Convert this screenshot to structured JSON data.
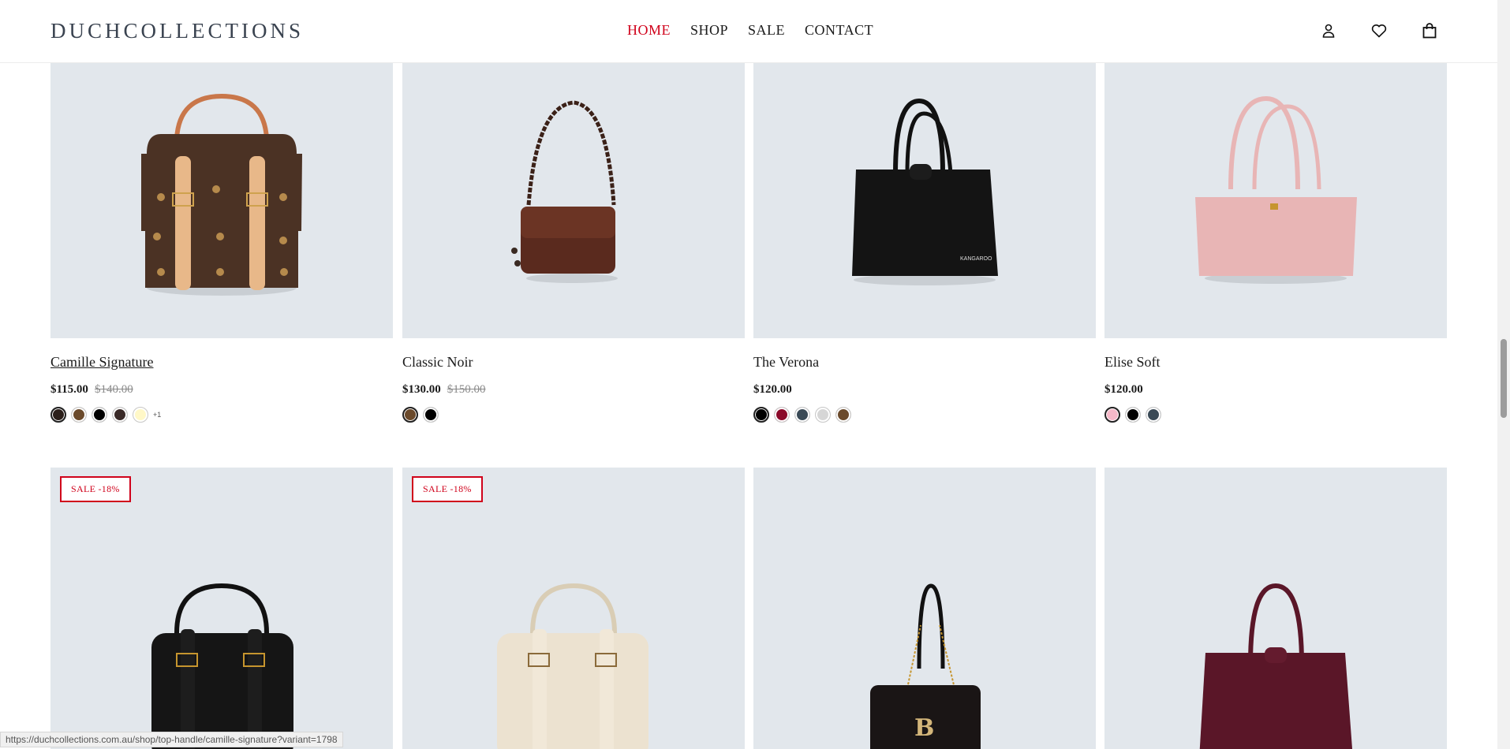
{
  "header": {
    "logo": "DUCHCOLLECTIONS",
    "nav": [
      {
        "label": "HOME",
        "active": true
      },
      {
        "label": "SHOP",
        "active": false
      },
      {
        "label": "SALE",
        "active": false
      },
      {
        "label": "CONTACT",
        "active": false
      }
    ],
    "icons": [
      "account-icon",
      "wishlist-heart-icon",
      "cart-bag-icon"
    ]
  },
  "products_row1": [
    {
      "title": "Camille Signature",
      "price": "$115.00",
      "old_price": "$140.00",
      "swatches": [
        "#2b1f1a",
        "#6b4a2b",
        "#000000",
        "#3a2a28",
        "#fff8c7"
      ],
      "more": "+1"
    },
    {
      "title": "Classic Noir",
      "price": "$130.00",
      "old_price": "$150.00",
      "swatches": [
        "#6b4a2b",
        "#000000"
      ],
      "more": ""
    },
    {
      "title": "The Verona",
      "price": "$120.00",
      "old_price": "",
      "swatches": [
        "#000000",
        "#8b0a2a",
        "#3a4a56",
        "#d6d6d6",
        "#6b4a2b"
      ],
      "more": ""
    },
    {
      "title": "Elise Soft",
      "price": "$120.00",
      "old_price": "",
      "swatches": [
        "#f6b8c8",
        "#000000",
        "#3a4a56"
      ],
      "more": ""
    }
  ],
  "products_row2": [
    {
      "badge": "SALE -18%"
    },
    {
      "badge": "SALE -18%"
    },
    {
      "badge": ""
    },
    {
      "badge": ""
    }
  ],
  "status_url": "https://duchcollections.com.au/shop/top-handle/camille-signature?variant=1798"
}
